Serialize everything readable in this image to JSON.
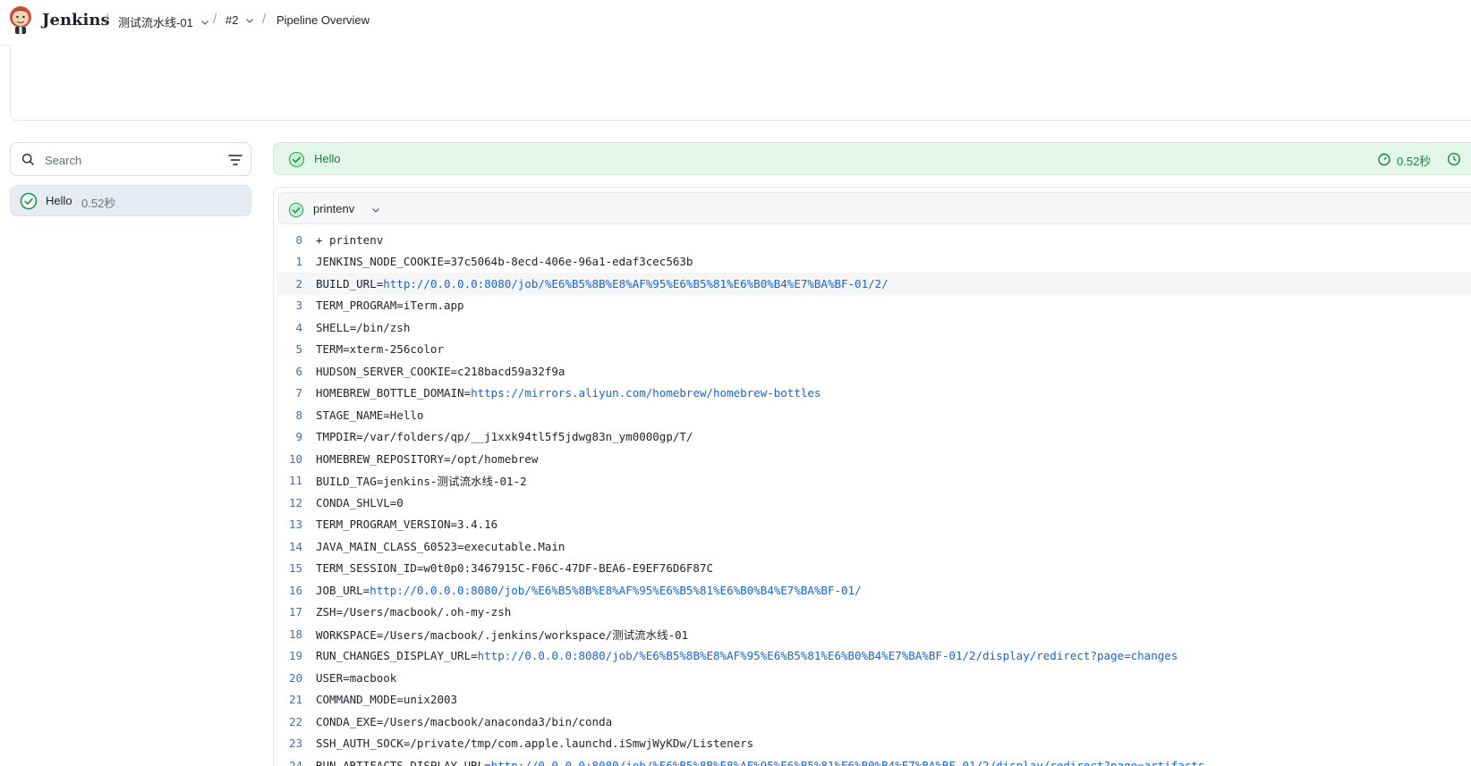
{
  "header": {
    "brand": "Jenkins",
    "breadcrumbs": [
      {
        "label": "测试流水线-01",
        "has_dropdown": true
      },
      {
        "label": "#2",
        "has_dropdown": true
      },
      {
        "label": "Pipeline Overview",
        "has_dropdown": false
      }
    ]
  },
  "sidebar": {
    "search_placeholder": "Search",
    "stages": [
      {
        "name": "Hello",
        "duration": "0.52秒",
        "status": "success"
      }
    ]
  },
  "stage": {
    "title": "Hello",
    "duration": "0.52秒",
    "status": "success"
  },
  "step": {
    "name": "printenv",
    "status": "success"
  },
  "log": [
    {
      "n": "0",
      "text": "+ printenv",
      "url": ""
    },
    {
      "n": "1",
      "text": "JENKINS_NODE_COOKIE=37c5064b-8ecd-406e-96a1-edaf3cec563b",
      "url": ""
    },
    {
      "n": "2",
      "text": "BUILD_URL=",
      "url": "http://0.0.0.0:8080/job/%E6%B5%8B%E8%AF%95%E6%B5%81%E6%B0%B4%E7%BA%BF-01/2/"
    },
    {
      "n": "3",
      "text": "TERM_PROGRAM=iTerm.app",
      "url": ""
    },
    {
      "n": "4",
      "text": "SHELL=/bin/zsh",
      "url": ""
    },
    {
      "n": "5",
      "text": "TERM=xterm-256color",
      "url": ""
    },
    {
      "n": "6",
      "text": "HUDSON_SERVER_COOKIE=c218bacd59a32f9a",
      "url": ""
    },
    {
      "n": "7",
      "text": "HOMEBREW_BOTTLE_DOMAIN=",
      "url": "https://mirrors.aliyun.com/homebrew/homebrew-bottles"
    },
    {
      "n": "8",
      "text": "STAGE_NAME=Hello",
      "url": ""
    },
    {
      "n": "9",
      "text": "TMPDIR=/var/folders/qp/__j1xxk94tl5f5jdwg83n_ym0000gp/T/",
      "url": ""
    },
    {
      "n": "10",
      "text": "HOMEBREW_REPOSITORY=/opt/homebrew",
      "url": ""
    },
    {
      "n": "11",
      "text": "BUILD_TAG=jenkins-测试流水线-01-2",
      "url": ""
    },
    {
      "n": "12",
      "text": "CONDA_SHLVL=0",
      "url": ""
    },
    {
      "n": "13",
      "text": "TERM_PROGRAM_VERSION=3.4.16",
      "url": ""
    },
    {
      "n": "14",
      "text": "JAVA_MAIN_CLASS_60523=executable.Main",
      "url": ""
    },
    {
      "n": "15",
      "text": "TERM_SESSION_ID=w0t0p0:3467915C-F06C-47DF-BEA6-E9EF76D6F87C",
      "url": ""
    },
    {
      "n": "16",
      "text": "JOB_URL=",
      "url": "http://0.0.0.0:8080/job/%E6%B5%8B%E8%AF%95%E6%B5%81%E6%B0%B4%E7%BA%BF-01/"
    },
    {
      "n": "17",
      "text": "ZSH=/Users/macbook/.oh-my-zsh",
      "url": ""
    },
    {
      "n": "18",
      "text": "WORKSPACE=/Users/macbook/.jenkins/workspace/测试流水线-01",
      "url": ""
    },
    {
      "n": "19",
      "text": "RUN_CHANGES_DISPLAY_URL=",
      "url": "http://0.0.0.0:8080/job/%E6%B5%8B%E8%AF%95%E6%B5%81%E6%B0%B4%E7%BA%BF-01/2/display/redirect?page=changes"
    },
    {
      "n": "20",
      "text": "USER=macbook",
      "url": ""
    },
    {
      "n": "21",
      "text": "COMMAND_MODE=unix2003",
      "url": ""
    },
    {
      "n": "22",
      "text": "CONDA_EXE=/Users/macbook/anaconda3/bin/conda",
      "url": ""
    },
    {
      "n": "23",
      "text": "SSH_AUTH_SOCK=/private/tmp/com.apple.launchd.iSmwjWyKDw/Listeners",
      "url": ""
    },
    {
      "n": "24",
      "text": "RUN_ARTIFACTS_DISPLAY_URL=",
      "url": "http://0.0.0.0:8080/job/%E6%B5%8B%E8%AF%95%E6%B5%81%E6%B0%B4%E7%BA%BF-01/2/display/redirect?page=artifacts"
    }
  ],
  "highlighted_line": "2",
  "colors": {
    "success": "#18863d",
    "success_bg": "#e4f5ea",
    "link": "#1565d8",
    "line_number": "#4a6da8"
  }
}
